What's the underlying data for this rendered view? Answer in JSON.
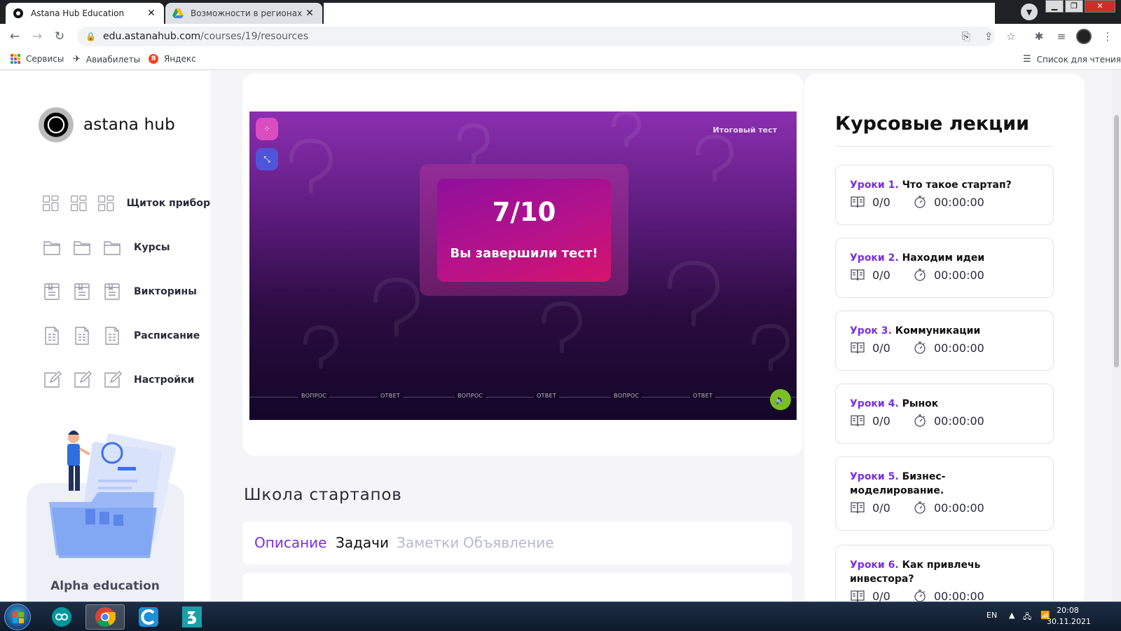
{
  "browser": {
    "tabs": [
      {
        "title": "Astana Hub Education",
        "active": true
      },
      {
        "title": "Возможности в регионах Каз",
        "active": false
      }
    ],
    "url_host": "edu.astanahub.com",
    "url_path": "/courses/19/resources",
    "bookmarks": [
      {
        "label": "Сервисы",
        "icon": "apps-grid-icon"
      },
      {
        "label": "Авиабилеты",
        "icon": "plane-icon"
      },
      {
        "label": "Яндекс",
        "icon": "yandex-icon"
      }
    ],
    "reading_list": "Список для чтения"
  },
  "sidebar": {
    "logo_text": "astana hub",
    "menu": [
      {
        "label": "Щиток прибор",
        "icon": "dashboard-icon"
      },
      {
        "label": "Курсы",
        "icon": "folder-icon"
      },
      {
        "label": "Викторины",
        "icon": "quiz-icon"
      },
      {
        "label": "Расписание",
        "icon": "schedule-icon"
      },
      {
        "label": "Настройки",
        "icon": "edit-icon"
      }
    ],
    "promo_title": "Alpha education"
  },
  "player": {
    "tag": "Итоговый тест",
    "score": "7/10",
    "message": "Вы завершили тест!",
    "timeline_labels": [
      "ВОПРОС",
      "ОТВЕТ",
      "ВОПРОС",
      "ОТВЕТ",
      "ВОПРОС",
      "ОТВЕТ"
    ]
  },
  "course": {
    "title": "Школа стартапов",
    "tabs": [
      {
        "label": "Описание",
        "state": "active"
      },
      {
        "label": "Задачи",
        "state": "normal"
      },
      {
        "label": "Заметки",
        "state": "muted"
      },
      {
        "label": "Объявление",
        "state": "muted"
      }
    ]
  },
  "lectures": {
    "title": "Курсовые лекции",
    "items": [
      {
        "num": "Уроки 1.",
        "name": "Что такое стартап?",
        "count": "0/0",
        "time": "00:00:00"
      },
      {
        "num": "Уроки 2.",
        "name": "Находим идеи",
        "count": "0/0",
        "time": "00:00:00"
      },
      {
        "num": "Урок 3.",
        "name": "Коммуникации",
        "count": "0/0",
        "time": "00:00:00"
      },
      {
        "num": "Уроки 4.",
        "name": "Рынок",
        "count": "0/0",
        "time": "00:00:00"
      },
      {
        "num": "Уроки 5.",
        "name": "Бизнес-моделирование.",
        "count": "0/0",
        "time": "00:00:00"
      },
      {
        "num": "Уроки 6.",
        "name": "Как привлечь инвестора?",
        "count": "0/0",
        "time": "00:00:00"
      }
    ]
  },
  "taskbar": {
    "lang": "EN",
    "time": "20:08",
    "date": "30.11.2021"
  },
  "colors": {
    "accent": "#7a2ee6",
    "muted_tab": "#b8b8cf",
    "player_top": "#8b2fb0",
    "player_bottom": "#140628",
    "sound_button": "#7bbf22"
  }
}
